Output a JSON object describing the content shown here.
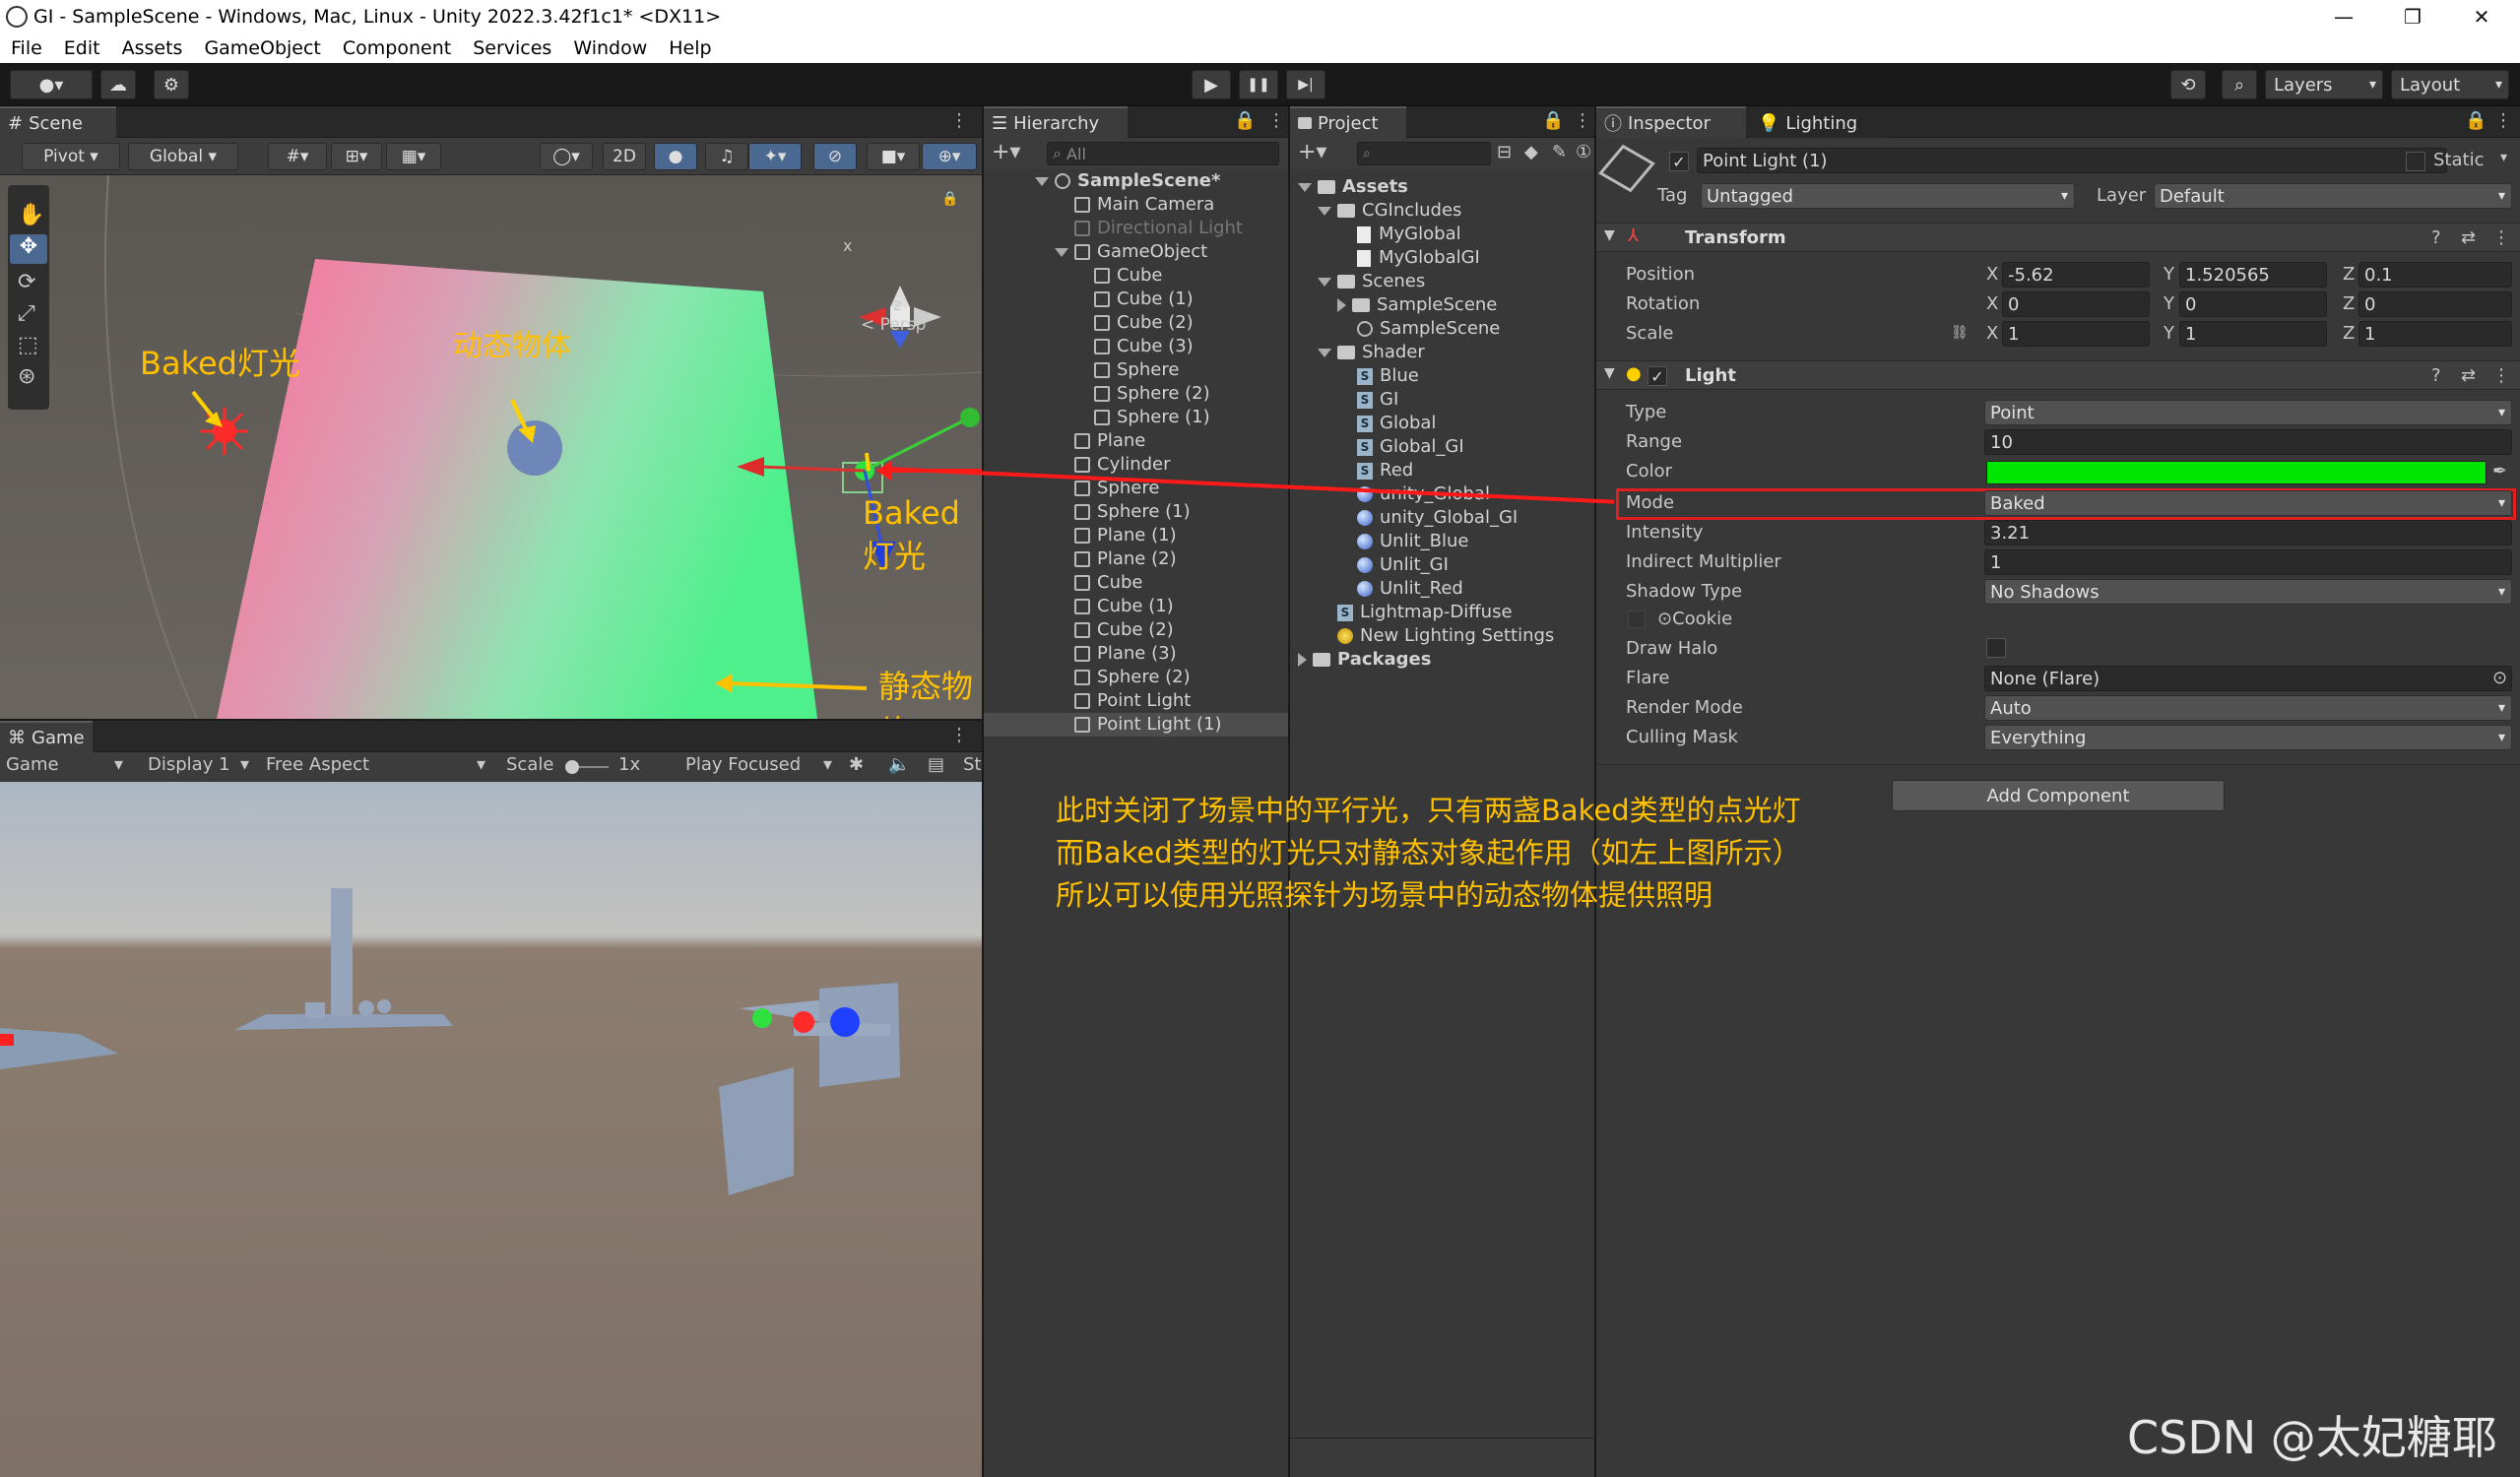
{
  "window": {
    "title": "GI - SampleScene - Windows, Mac, Linux - Unity 2022.3.42f1c1* <DX11>",
    "min": "—",
    "max": "❐",
    "close": "✕"
  },
  "menu": [
    "File",
    "Edit",
    "Assets",
    "GameObject",
    "Component",
    "Services",
    "Window",
    "Help"
  ],
  "toolbar": {
    "layers": "Layers",
    "layout": "Layout",
    "play": "▶",
    "pause": "❚❚",
    "step": "▶|"
  },
  "scene": {
    "tab": "Scene",
    "pivot": "Pivot",
    "global": "Global",
    "btn2d": "2D",
    "persp": "< Persp",
    "axis_x": "x",
    "axis_z": "z"
  },
  "annotations": {
    "baked_light_1": "Baked灯光",
    "dynamic_object": "动态物体",
    "baked_light_2": "Baked灯光",
    "static_object": "静态物体",
    "explanation": [
      "此时关闭了场景中的平行光，只有两盏Baked类型的点光灯",
      "而Baked类型的灯光只对静态对象起作用（如左上图所示）",
      "所以可以使用光照探针为场景中的动态物体提供照明"
    ]
  },
  "game": {
    "tab": "Game",
    "mode": "Game",
    "display": "Display 1",
    "aspect": "Free Aspect",
    "scale_label": "Scale",
    "scale_value": "1x",
    "play_focused": "Play Focused",
    "st": "St"
  },
  "hierarchy": {
    "tab": "Hierarchy",
    "search": "All",
    "items": [
      "SampleScene*",
      "Main Camera",
      "Directional Light",
      "GameObject",
      "Cube",
      "Cube (1)",
      "Cube (2)",
      "Cube (3)",
      "Sphere",
      "Sphere (2)",
      "Sphere (1)",
      "Plane",
      "Cylinder",
      "Sphere",
      "Sphere (1)",
      "Plane (1)",
      "Plane (2)",
      "Cube",
      "Cube (1)",
      "Cube (2)",
      "Plane (3)",
      "Sphere (2)",
      "Point Light",
      "Point Light (1)"
    ]
  },
  "project": {
    "tab": "Project",
    "items": [
      "Assets",
      "CGIncludes",
      "MyGlobal",
      "MyGlobalGI",
      "Scenes",
      "SampleScene",
      "SampleScene",
      "Shader",
      "Blue",
      "GI",
      "Global",
      "Global_GI",
      "Red",
      "unity_Global",
      "unity_Global_GI",
      "Unlit_Blue",
      "Unlit_GI",
      "Unlit_Red",
      "Lightmap-Diffuse",
      "New Lighting Settings",
      "Packages"
    ]
  },
  "inspector": {
    "tab": "Inspector",
    "tab2": "Lighting",
    "object_name": "Point Light (1)",
    "static": "Static",
    "tag_label": "Tag",
    "tag": "Untagged",
    "layer_label": "Layer",
    "layer": "Default",
    "transform": {
      "title": "Transform",
      "position": "Position",
      "rotation": "Rotation",
      "scale": "Scale",
      "pos": [
        "-5.62",
        "1.520565",
        "0.1"
      ],
      "rot": [
        "0",
        "0",
        "0"
      ],
      "scl": [
        "1",
        "1",
        "1"
      ],
      "X": "X",
      "Y": "Y",
      "Z": "Z"
    },
    "light": {
      "title": "Light",
      "type_label": "Type",
      "type": "Point",
      "range_label": "Range",
      "range": "10",
      "color_label": "Color",
      "color": "#00e600",
      "mode_label": "Mode",
      "mode": "Baked",
      "intensity_label": "Intensity",
      "intensity": "3.21",
      "indirect_label": "Indirect Multiplier",
      "indirect": "1",
      "shadow_label": "Shadow Type",
      "shadow": "No Shadows",
      "cookie_label": "Cookie",
      "halo_label": "Draw Halo",
      "flare_label": "Flare",
      "flare": "None (Flare)",
      "render_label": "Render Mode",
      "render": "Auto",
      "culling_label": "Culling Mask",
      "culling": "Everything"
    },
    "add_component": "Add Component"
  },
  "watermark": "CSDN @太妃糖耶"
}
